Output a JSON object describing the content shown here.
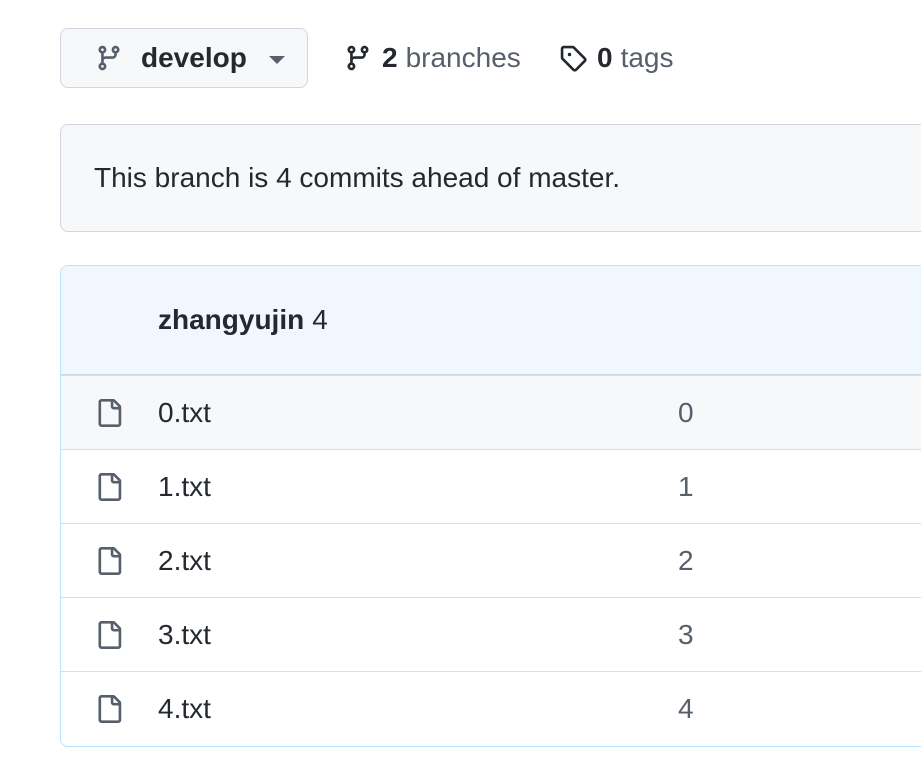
{
  "branch_selector": {
    "current_branch": "develop",
    "icon": "git-branch-icon"
  },
  "branches_link": {
    "count": "2",
    "label": "branches",
    "icon": "git-branch-icon"
  },
  "tags_link": {
    "count": "0",
    "label": "tags",
    "icon": "tag-icon"
  },
  "notice": {
    "text": "This branch is 4 commits ahead of master."
  },
  "latest_commit": {
    "author": "zhangyujin",
    "message": "4"
  },
  "files": [
    {
      "name": "0.txt",
      "commit_message": "0",
      "icon": "file-icon"
    },
    {
      "name": "1.txt",
      "commit_message": "1",
      "icon": "file-icon"
    },
    {
      "name": "2.txt",
      "commit_message": "2",
      "icon": "file-icon"
    },
    {
      "name": "3.txt",
      "commit_message": "3",
      "icon": "file-icon"
    },
    {
      "name": "4.txt",
      "commit_message": "4",
      "icon": "file-icon"
    }
  ],
  "colors": {
    "header_bg": "#f0f7ff",
    "border": "#d0d7de",
    "muted_text": "#57606a",
    "primary_text": "#24292f"
  }
}
